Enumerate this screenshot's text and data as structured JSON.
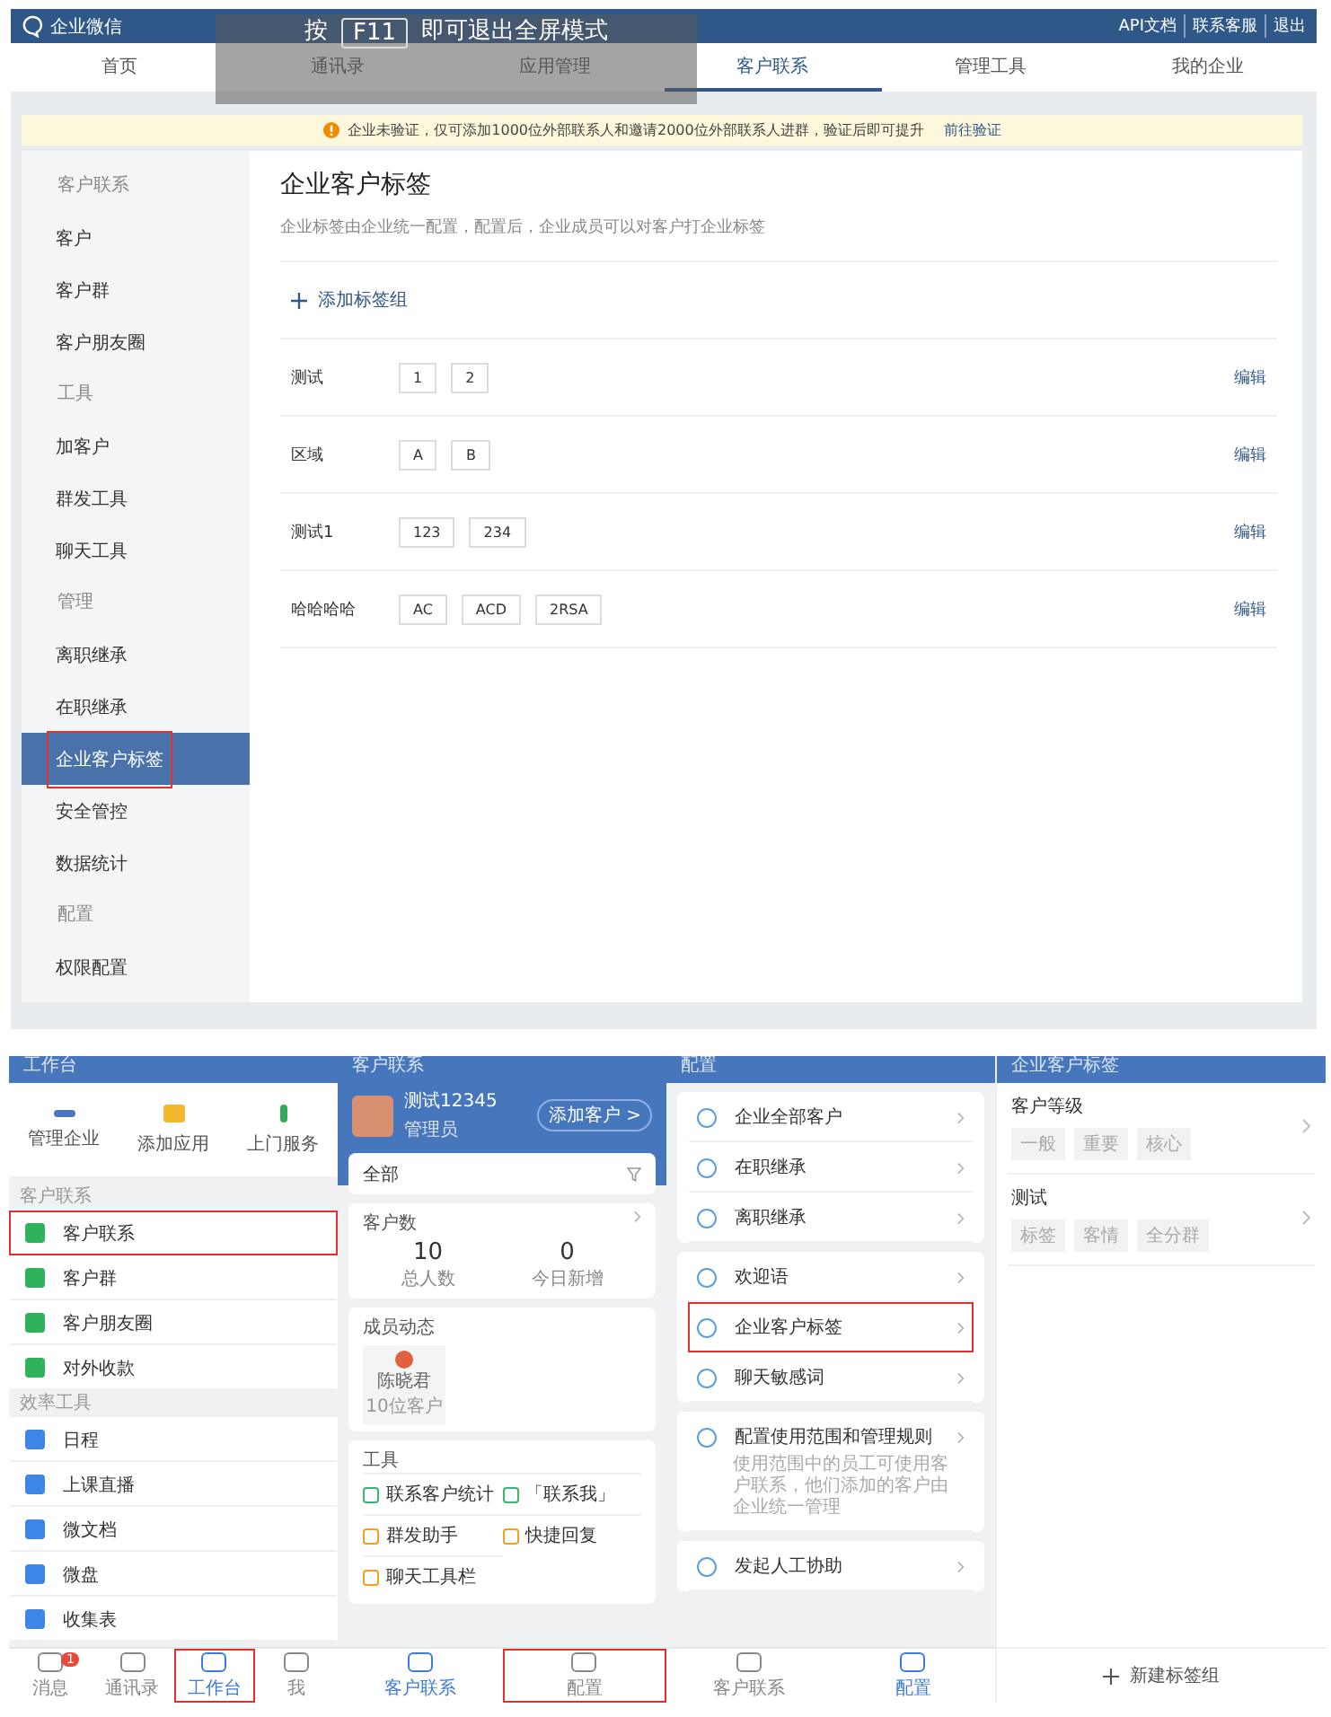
{
  "web": {
    "brand": "企业微信",
    "header_links": [
      "API文档",
      "联系客服",
      "退出"
    ],
    "nav": [
      {
        "label": "首页",
        "selected": false
      },
      {
        "label": "通讯录",
        "selected": false
      },
      {
        "label": "应用管理",
        "selected": false
      },
      {
        "label": "客户联系",
        "selected": true
      },
      {
        "label": "管理工具",
        "selected": false
      },
      {
        "label": "我的企业",
        "selected": false
      }
    ],
    "fullscreen_toast": {
      "before": "按",
      "key": "F11",
      "after": "即可退出全屏模式"
    },
    "notice": {
      "text": "企业未验证，仅可添加1000位外部联系人和邀请2000位外部联系人进群，验证后即可提升",
      "link": "前往验证"
    },
    "sidebar": [
      {
        "kind": "heading",
        "label": "客户联系"
      },
      {
        "kind": "item",
        "label": "客户",
        "selected": false,
        "highlighted": false
      },
      {
        "kind": "item",
        "label": "客户群",
        "selected": false,
        "highlighted": false
      },
      {
        "kind": "item",
        "label": "客户朋友圈",
        "selected": false,
        "highlighted": false
      },
      {
        "kind": "heading",
        "label": "工具"
      },
      {
        "kind": "item",
        "label": "加客户",
        "selected": false,
        "highlighted": false
      },
      {
        "kind": "item",
        "label": "群发工具",
        "selected": false,
        "highlighted": false
      },
      {
        "kind": "item",
        "label": "聊天工具",
        "selected": false,
        "highlighted": false
      },
      {
        "kind": "heading",
        "label": "管理"
      },
      {
        "kind": "item",
        "label": "离职继承",
        "selected": false,
        "highlighted": false
      },
      {
        "kind": "item",
        "label": "在职继承",
        "selected": false,
        "highlighted": false
      },
      {
        "kind": "item",
        "label": "企业客户标签",
        "selected": true,
        "highlighted": true
      },
      {
        "kind": "item",
        "label": "安全管控",
        "selected": false,
        "highlighted": false
      },
      {
        "kind": "item",
        "label": "数据统计",
        "selected": false,
        "highlighted": false
      },
      {
        "kind": "heading",
        "label": "配置"
      },
      {
        "kind": "item",
        "label": "权限配置",
        "selected": false,
        "highlighted": false
      }
    ],
    "page": {
      "title": "企业客户标签",
      "subtitle": "企业标签由企业统一配置，配置后，企业成员可以对客户打企业标签",
      "add_button": "添加标签组",
      "groups": [
        {
          "name": "测试",
          "tags": [
            "1",
            "2"
          ],
          "action": "编辑"
        },
        {
          "name": "区域",
          "tags": [
            "A",
            "B"
          ],
          "action": "编辑"
        },
        {
          "name": "测试1",
          "tags": [
            "123",
            "234"
          ],
          "action": "编辑"
        },
        {
          "name": "哈哈哈哈",
          "tags": [
            "AC",
            "ACD",
            "2RSA"
          ],
          "action": "编辑"
        }
      ]
    }
  },
  "mobile": {
    "workbench": {
      "title": "工作台",
      "shortcuts": [
        "管理企业",
        "添加应用",
        "上门服务"
      ],
      "sections": [
        {
          "heading": "客户联系",
          "items": [
            {
              "label": "客户联系",
              "highlighted": true
            },
            {
              "label": "客户群",
              "highlighted": false
            },
            {
              "label": "客户朋友圈",
              "highlighted": false
            },
            {
              "label": "对外收款",
              "highlighted": false
            }
          ]
        },
        {
          "heading": "效率工具",
          "items": [
            {
              "label": "日程",
              "highlighted": false
            },
            {
              "label": "上课直播",
              "highlighted": false
            },
            {
              "label": "微文档",
              "highlighted": false
            },
            {
              "label": "微盘",
              "highlighted": false
            },
            {
              "label": "收集表",
              "highlighted": false
            }
          ]
        }
      ],
      "tabs": [
        {
          "label": "消息",
          "badge": "1",
          "selected": false,
          "highlighted": false
        },
        {
          "label": "通讯录",
          "selected": false,
          "highlighted": false
        },
        {
          "label": "工作台",
          "selected": true,
          "highlighted": true
        },
        {
          "label": "我",
          "selected": false,
          "highlighted": false
        }
      ]
    },
    "customer_contact": {
      "title": "客户联系",
      "profile": {
        "name": "测试12345",
        "role": "管理员",
        "button": "添加客户 >"
      },
      "filter": "全部",
      "stats": {
        "title": "客户数",
        "items": [
          {
            "value": "10",
            "label": "总人数"
          },
          {
            "value": "0",
            "label": "今日新增"
          }
        ]
      },
      "members": {
        "title": "成员动态",
        "cards": [
          {
            "name": "陈晓君",
            "detail": "10位客户"
          }
        ]
      },
      "tools": {
        "title": "工具",
        "items": [
          "联系客户统计",
          "「联系我」",
          "群发助手",
          "快捷回复",
          "聊天工具栏"
        ]
      },
      "tabs": [
        {
          "label": "客户联系",
          "selected": true,
          "highlighted": false
        },
        {
          "label": "配置",
          "selected": false,
          "highlighted": true
        }
      ]
    },
    "config": {
      "title": "配置",
      "cards": [
        {
          "items": [
            {
              "label": "企业全部客户",
              "highlighted": false
            },
            {
              "label": "在职继承",
              "highlighted": false
            },
            {
              "label": "离职继承",
              "highlighted": false
            }
          ]
        },
        {
          "items": [
            {
              "label": "欢迎语",
              "highlighted": false
            },
            {
              "label": "企业客户标签",
              "highlighted": true
            },
            {
              "label": "聊天敏感词",
              "highlighted": false
            }
          ]
        },
        {
          "items": [
            {
              "label": "配置使用范围和管理规则",
              "description": "使用范围中的员工可使用客户联系，他们添加的客户由企业统一管理",
              "highlighted": false
            }
          ]
        },
        {
          "items": [
            {
              "label": "发起人工协助",
              "highlighted": false
            }
          ]
        }
      ],
      "tabs": [
        {
          "label": "客户联系",
          "selected": false
        },
        {
          "label": "配置",
          "selected": true
        }
      ]
    },
    "tags": {
      "title": "企业客户标签",
      "groups": [
        {
          "name": "客户等级",
          "tags": [
            "一般",
            "重要",
            "核心"
          ]
        },
        {
          "name": "测试",
          "tags": [
            "标签",
            "客情",
            "全分群"
          ]
        }
      ],
      "add_button": "新建标签组"
    }
  }
}
